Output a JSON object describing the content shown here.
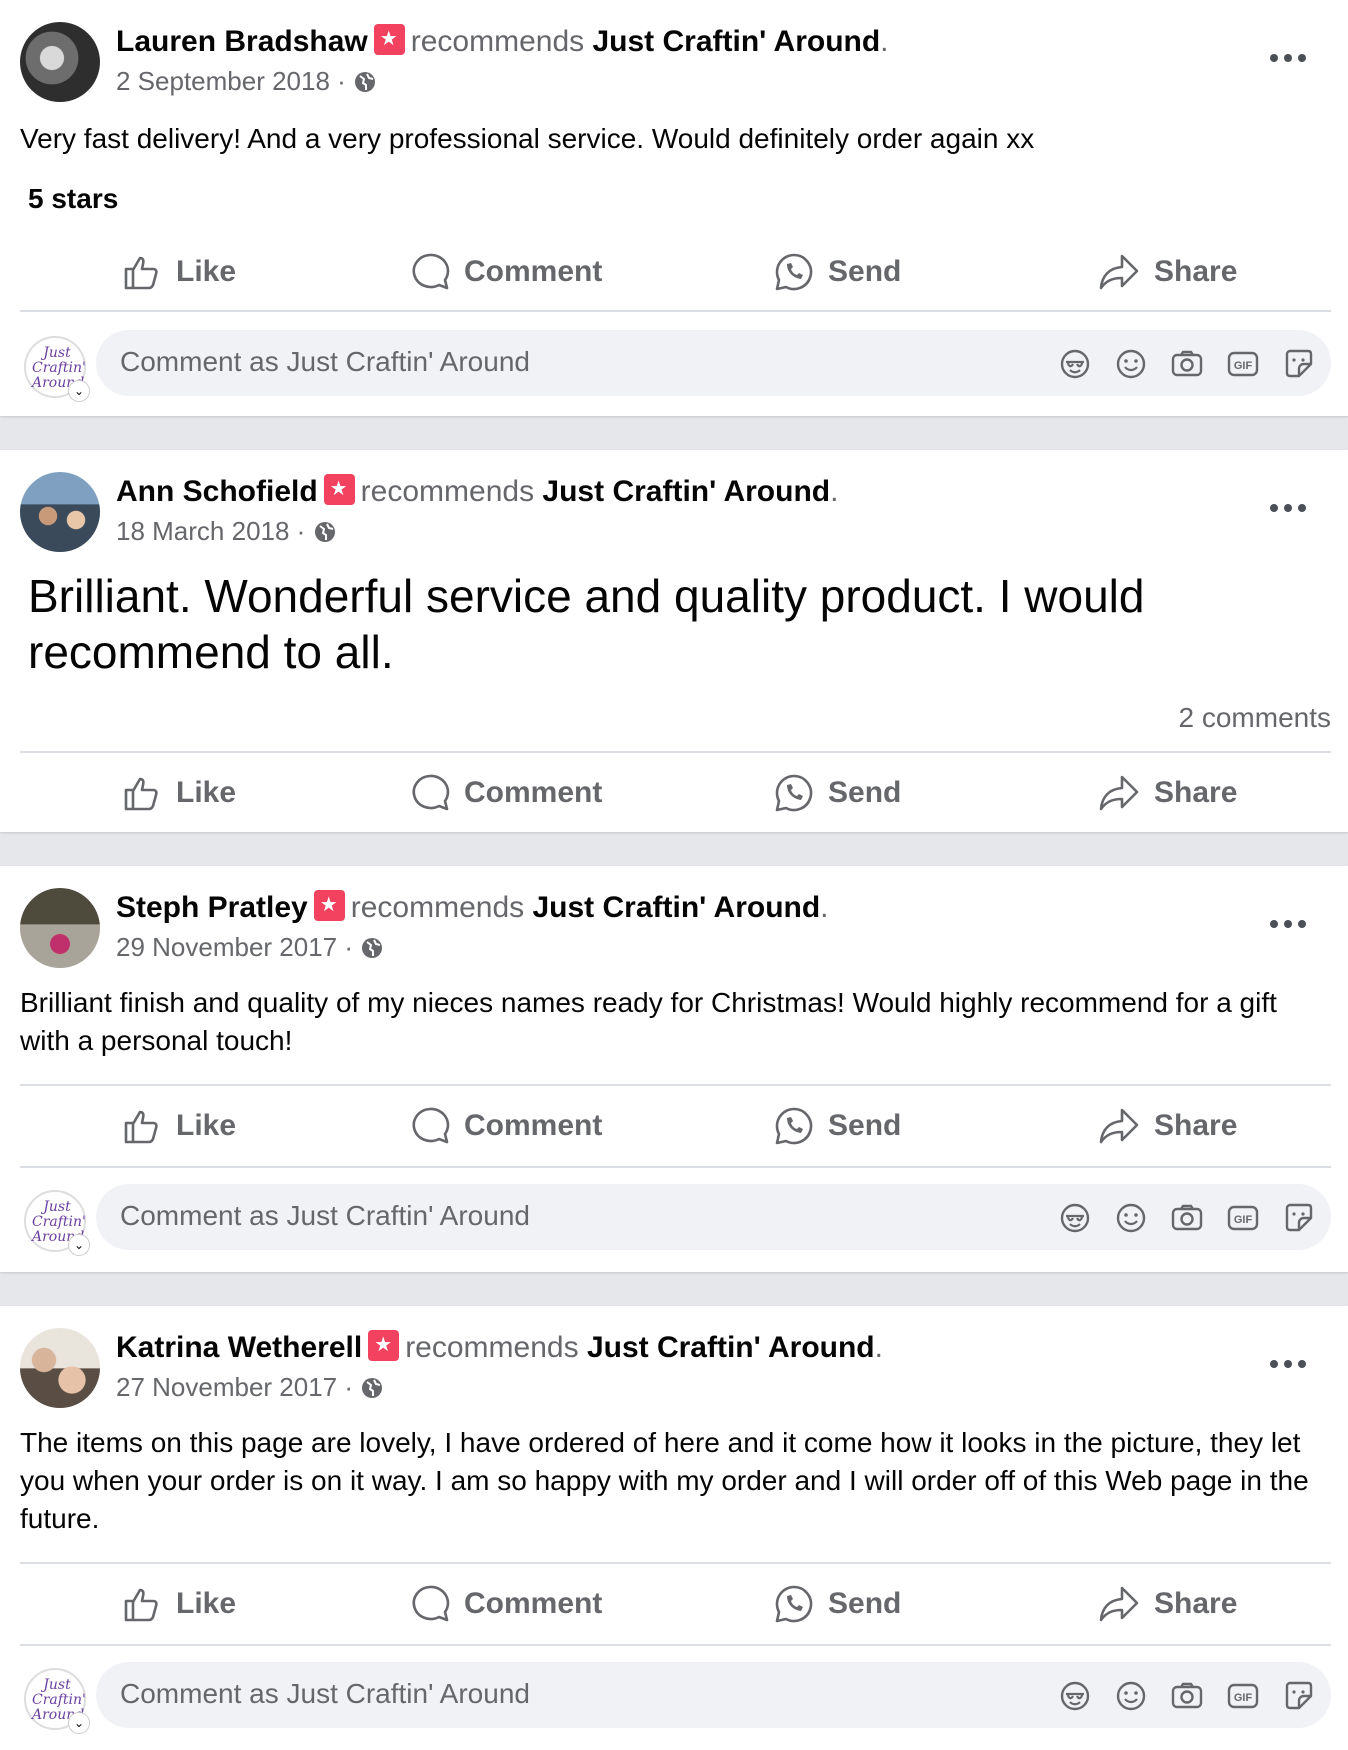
{
  "page_name": "Just Craftin' Around",
  "recommends_word": "recommends",
  "actions": {
    "like": "Like",
    "comment": "Comment",
    "send": "Send",
    "share": "Share"
  },
  "comment_placeholder": "Comment as Just Craftin' Around",
  "page_avatar_text": "Just Craftin' Around",
  "comment_icons": [
    "avatar-sticker-icon",
    "emoji-icon",
    "camera-icon",
    "gif-icon",
    "sticker-icon"
  ],
  "colors": {
    "recommend_badge": "#f3425f",
    "secondary_text": "#65676b",
    "page_avatar_purple": "#6b3fa0"
  },
  "posts": [
    {
      "author": "Lauren Bradshaw",
      "date": "2 September 2018",
      "text": "Very fast delivery! And a very professional service. Would definitely order again xx",
      "extra": "5 stars"
    },
    {
      "author": "Ann Schofield",
      "date": "18 March 2018",
      "text": "Brilliant. Wonderful service and quality product. I would recommend to all.",
      "comments_count": "2 comments"
    },
    {
      "author": "Steph Pratley",
      "date": "29 November 2017",
      "text": "Brilliant finish and quality of my nieces names ready for Christmas! Would highly recommend for a gift with a personal touch!"
    },
    {
      "author": "Katrina Wetherell",
      "date": "27 November 2017",
      "text": "The items on this page are lovely, I have ordered of here and it come how it looks in the picture, they let you when your order is on it way. I am so happy with my order and I will order off of this Web page in the future."
    }
  ]
}
